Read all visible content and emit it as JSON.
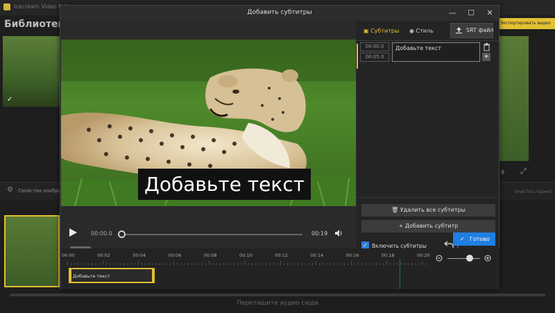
{
  "background_app": {
    "title": "Icecream Video Edito",
    "library_title": "Библиотека",
    "export_label": "Экспортировать видео",
    "props_label": "Свойства изображ",
    "props_right_label": "Очистить проект",
    "audio_hint": "Перетащите аудио сюда",
    "preview_count": "9"
  },
  "dialog": {
    "title": "Добавить субтитры",
    "window_controls": {
      "minimize": "—",
      "maximize": "☐",
      "close": "✕"
    }
  },
  "video": {
    "subtitle_overlay": "Добавьте текст"
  },
  "player": {
    "time_current": "00:00.0",
    "time_total": "00:19",
    "progress": 0.0
  },
  "panel": {
    "tabs": [
      {
        "label": "Субтитры",
        "icon": "subtitles-icon",
        "active": true
      },
      {
        "label": "Стиль",
        "icon": "palette-icon",
        "active": false
      }
    ],
    "srt_button": "SRT файл",
    "subtitle_entry": {
      "start": "00:00.0",
      "end": "00:05.0",
      "text": "Добавьте текст"
    },
    "delete_all_button": "Удалить все субтитры",
    "add_subtitle_button": "Добавить субтитр",
    "enable_subtitles_label": "Включить субтитры",
    "enable_subtitles_checked": true,
    "done_button": "Готово"
  },
  "timeline": {
    "ticks": [
      "00:00",
      "00:02",
      "00:04",
      "00:06",
      "00:08",
      "00:10",
      "00:12",
      "00:14",
      "00:16",
      "00:18",
      "00:20"
    ],
    "clip_label": "Добавьте текст"
  },
  "colors": {
    "accent_yellow": "#e2c032",
    "accent_blue": "#1e7fe0",
    "panel_bg": "#242424"
  }
}
